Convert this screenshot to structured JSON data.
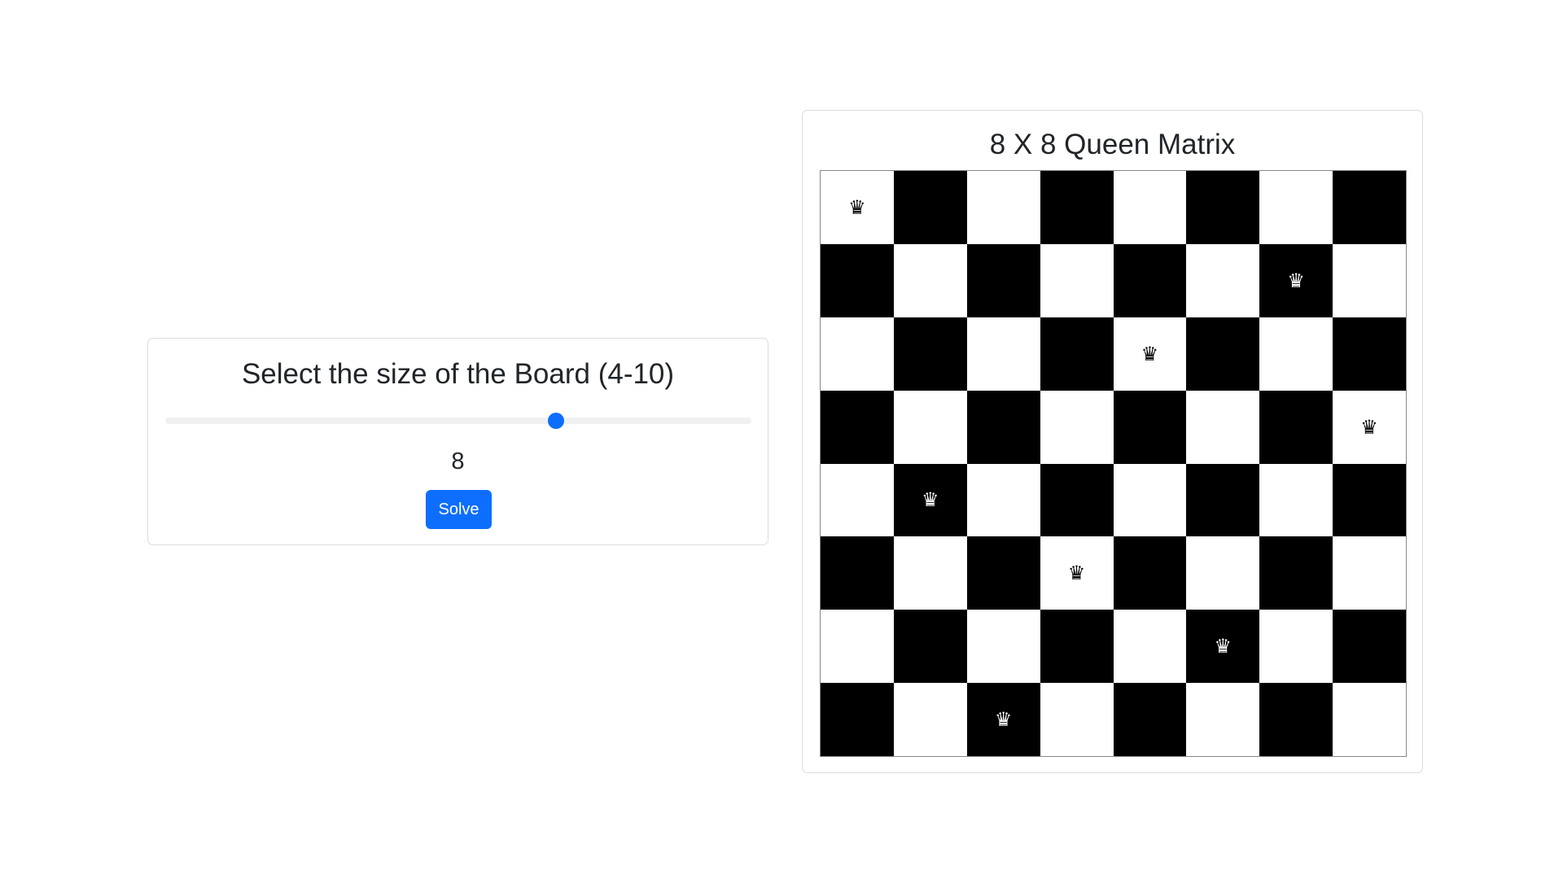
{
  "size_panel": {
    "title": "Select the size of the Board (4-10)",
    "slider": {
      "min": 4,
      "max": 10,
      "value": 8,
      "thumb_color": "#0d6efd"
    },
    "value_text": "8",
    "solve_label": "Solve",
    "solve_color": "#0d6efd"
  },
  "board_panel": {
    "title": "8 X 8 Queen Matrix",
    "size": 8,
    "queen_icon": "queen-icon",
    "queen_glyph": "♛",
    "queen_columns_by_row": [
      0,
      6,
      4,
      7,
      1,
      3,
      5,
      2
    ],
    "colors": {
      "light": "#ffffff",
      "dark": "#000000"
    }
  }
}
